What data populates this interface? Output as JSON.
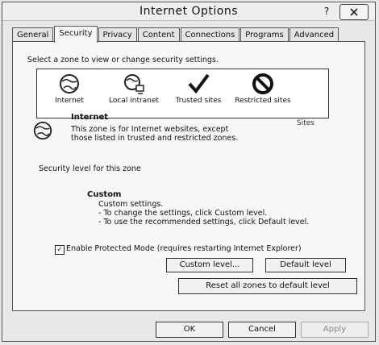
{
  "window": {
    "title": "Internet Options",
    "help": "?"
  },
  "tabs": [
    {
      "label": "General"
    },
    {
      "label": "Security"
    },
    {
      "label": "Privacy"
    },
    {
      "label": "Content"
    },
    {
      "label": "Connections"
    },
    {
      "label": "Programs"
    },
    {
      "label": "Advanced"
    }
  ],
  "active_tab": "Security",
  "zones": {
    "instruction": "Select a zone to view or change security settings.",
    "items": [
      {
        "label": "Internet",
        "icon": "globe-icon"
      },
      {
        "label": "Local intranet",
        "icon": "intranet-icon"
      },
      {
        "label": "Trusted sites",
        "icon": "checkmark-icon"
      },
      {
        "label": "Restricted sites",
        "icon": "no-entry-icon"
      }
    ]
  },
  "selected_zone": {
    "title": "Internet",
    "description": "This zone is for Internet websites, except those listed in trusted and restricted zones.",
    "sites_button": "Sites"
  },
  "security_level": {
    "label": "Security level for this zone",
    "title": "Custom",
    "lines": [
      "Custom settings.",
      "- To change the settings, click Custom level.",
      "- To use the recommended settings, click Default level."
    ]
  },
  "protected_mode": {
    "label": "Enable Protected Mode (requires restarting Internet Explorer)",
    "checked": true
  },
  "buttons": {
    "custom_level": "Custom level...",
    "default_level": "Default level",
    "reset_all": "Reset all zones to default level",
    "ok": "OK",
    "cancel": "Cancel",
    "apply": "Apply"
  }
}
